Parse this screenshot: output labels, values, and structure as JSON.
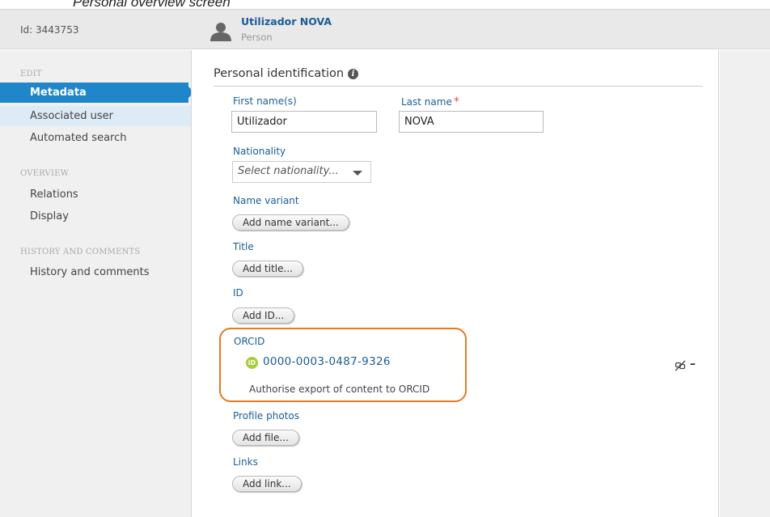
{
  "caption": "Personal overview screen",
  "header": {
    "id_text": "Id: 3443753",
    "name": "Utilizador NOVA",
    "type": "Person",
    "icon": "person-icon"
  },
  "sidebar": {
    "sections": [
      {
        "heading": "EDIT",
        "items": [
          "Metadata",
          "Associated user",
          "Automated search"
        ]
      },
      {
        "heading": "OVERVIEW",
        "items": [
          "Relations",
          "Display"
        ]
      },
      {
        "heading": "HISTORY AND COMMENTS",
        "items": [
          "History and comments"
        ]
      }
    ],
    "active_item": "Metadata"
  },
  "form": {
    "section_title": "Personal identification",
    "first_name": {
      "label": "First name(s)",
      "value": "Utilizador"
    },
    "last_name": {
      "label": "Last name",
      "value": "NOVA",
      "required_mark": "*"
    },
    "nationality": {
      "label": "Nationality",
      "placeholder": "Select nationality..."
    },
    "name_variant": {
      "label": "Name variant",
      "button": "Add name variant..."
    },
    "title": {
      "label": "Title",
      "button": "Add title..."
    },
    "id": {
      "label": "ID",
      "button": "Add ID..."
    },
    "orcid": {
      "label": "ORCID",
      "badge": "iD",
      "value": "0000-0003-0487-9326",
      "authorise_text": "Authorise export of content to ORCID",
      "remove_symbol": "–"
    },
    "profile_photos": {
      "label": "Profile photos",
      "button": "Add file..."
    },
    "links": {
      "label": "Links",
      "button": "Add link..."
    }
  },
  "colors": {
    "accent": "#1f86c9",
    "link": "#1a5d98",
    "highlight": "#e07b29",
    "orcid_green": "#a6ce39"
  }
}
